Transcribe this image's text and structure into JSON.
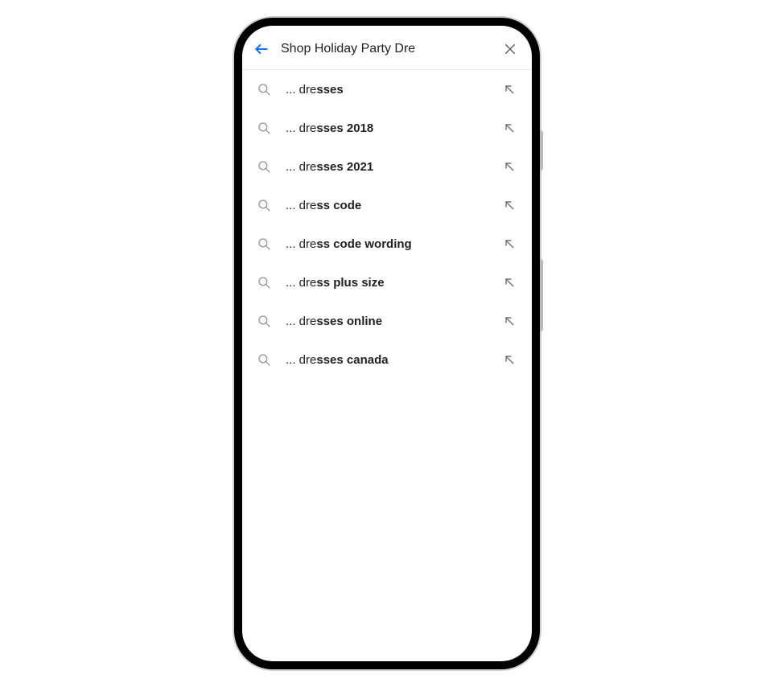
{
  "search": {
    "query": "Shop Holiday Party Dre"
  },
  "suggestions": [
    {
      "prefix": "... dre",
      "bold": "sses"
    },
    {
      "prefix": "... dre",
      "bold": "sses 2018"
    },
    {
      "prefix": "... dre",
      "bold": "sses 2021"
    },
    {
      "prefix": "... dre",
      "bold": "ss code"
    },
    {
      "prefix": "... dre",
      "bold": "ss code wording"
    },
    {
      "prefix": "... dre",
      "bold": "ss plus size"
    },
    {
      "prefix": "... dre",
      "bold": "sses online"
    },
    {
      "prefix": "... dre",
      "bold": "sses canada"
    }
  ],
  "colors": {
    "back_arrow": "#1a73e8",
    "icon_gray": "#9aa0a6",
    "text": "#202124"
  }
}
